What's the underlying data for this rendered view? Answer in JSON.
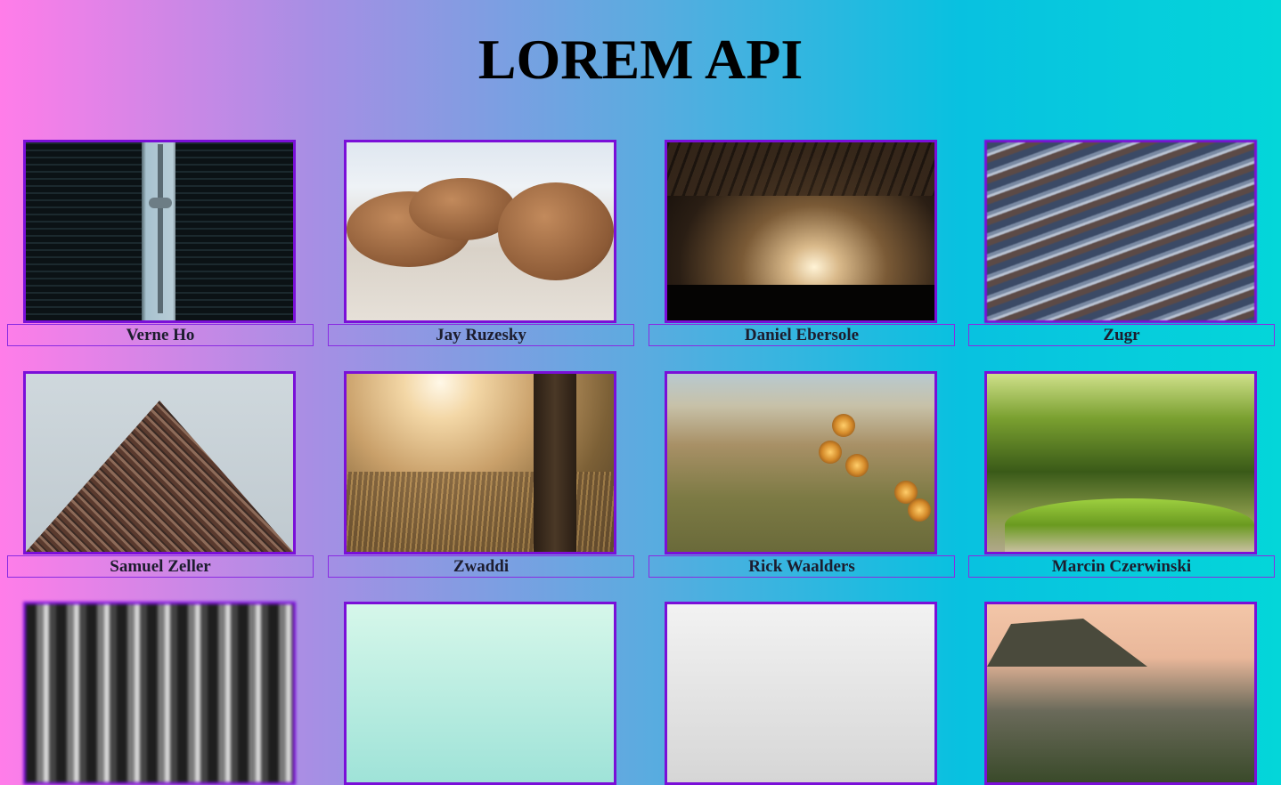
{
  "header": {
    "title": "LOREM API"
  },
  "gallery": {
    "items": [
      {
        "author": "Verne Ho",
        "image": "city-tower-photo"
      },
      {
        "author": "Jay Ruzesky",
        "image": "walrus-photo"
      },
      {
        "author": "Daniel Ebersole",
        "image": "concert-photo"
      },
      {
        "author": "Zugr",
        "image": "wet-rock-photo"
      },
      {
        "author": "Samuel Zeller",
        "image": "building-photo"
      },
      {
        "author": "Zwaddi",
        "image": "sunlit-field-photo"
      },
      {
        "author": "Rick Waalders",
        "image": "hills-flowers-photo"
      },
      {
        "author": "Marcin Czerwinski",
        "image": "moss-photo"
      },
      {
        "author": "",
        "image": "blurred-city-photo"
      },
      {
        "author": "",
        "image": "mint-sky-photo"
      },
      {
        "author": "",
        "image": "grey-sky-photo"
      },
      {
        "author": "",
        "image": "sunset-mountain-photo"
      }
    ]
  },
  "colors": {
    "gradient": [
      "#ff7de9",
      "#a58fe4",
      "#5cabe0",
      "#08c1e0",
      "#04d6d9"
    ],
    "frame_border": "#7a0fd8",
    "caption_border": "#8a2be2"
  }
}
